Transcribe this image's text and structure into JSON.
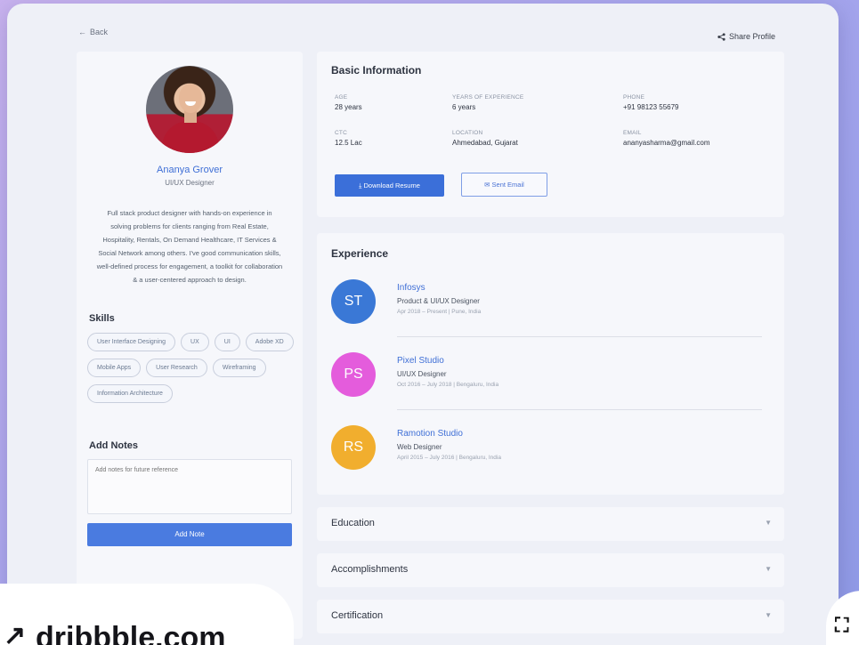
{
  "nav": {
    "back_label": "Back",
    "share_label": "Share Profile"
  },
  "profile": {
    "name": "Ananya Grover",
    "role": "UI/UX Designer",
    "bio": "Full stack product designer with hands-on experience in solving problems for clients ranging from Real Estate, Hospitality, Rentals, On Demand Healthcare, IT Services & Social Network among others. I've good communication skills, well-defined process for engagement, a toolkit for collaboration & a user-centered approach to design."
  },
  "skills": {
    "title": "Skills",
    "items": [
      "User Interface Designing",
      "UX",
      "UI",
      "Adobe XD",
      "Mobile Apps",
      "User Research",
      "Wireframing",
      "Information Architecture"
    ]
  },
  "notes": {
    "title": "Add Notes",
    "placeholder": "Add notes for future reference",
    "button_label": "Add Note"
  },
  "basic_info": {
    "title": "Basic Information",
    "fields": [
      {
        "label": "AGE",
        "value": "28 years"
      },
      {
        "label": "YEARS OF EXPERIENCE",
        "value": "6 years"
      },
      {
        "label": "PHONE",
        "value": "+91 98123 55679"
      },
      {
        "label": "CTC",
        "value": "12.5 Lac"
      },
      {
        "label": "LOCATION",
        "value": "Ahmedabad, Gujarat"
      },
      {
        "label": "EMAIL",
        "value": "ananyasharma@gmail.com"
      }
    ],
    "download_label": "Download Resume",
    "email_label": "Sent Email"
  },
  "experience": {
    "title": "Experience",
    "items": [
      {
        "initials": "ST",
        "company": "Infosys",
        "role": "Product & UI/UX Designer",
        "dates": "Apr 2018 – Present  |  Pune, India",
        "color": "#3a78d6"
      },
      {
        "initials": "PS",
        "company": "Pixel Studio",
        "role": "UI/UX Designer",
        "dates": "Oct 2016 – July 2018  |  Bengaluru, India",
        "color": "#e45cdc"
      },
      {
        "initials": "RS",
        "company": "Ramotion Studio",
        "role": "Web Designer",
        "dates": "April 2015 – July 2016  |  Bengaluru, India",
        "color": "#f1ae2e"
      }
    ]
  },
  "sections": [
    {
      "title": "Education"
    },
    {
      "title": "Accomplishments"
    },
    {
      "title": "Certification"
    }
  ],
  "watermark": {
    "text": "dribbble.com",
    "icon": "external-link-icon"
  },
  "colors": {
    "accent": "#3b6fd9",
    "link": "#3f6fd6",
    "background": "#eef0f7"
  }
}
